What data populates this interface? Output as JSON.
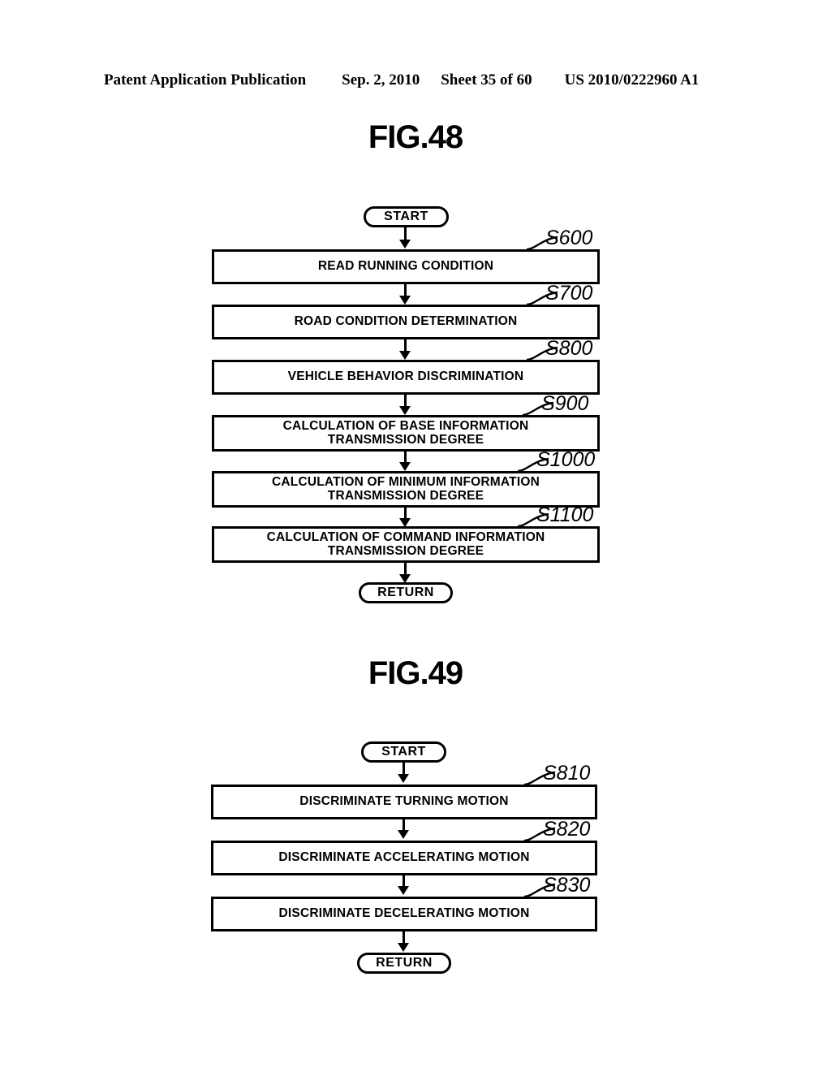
{
  "header": {
    "publication": "Patent Application Publication",
    "date": "Sep. 2, 2010",
    "sheet": "Sheet 35 of 60",
    "patent_number": "US 2010/0222960 A1"
  },
  "figures": [
    {
      "title": "FIG.48",
      "start_label": "START",
      "return_label": "RETURN",
      "steps": [
        {
          "ref": "S600",
          "line1": "READ RUNNING CONDITION",
          "line2": ""
        },
        {
          "ref": "S700",
          "line1": "ROAD CONDITION DETERMINATION",
          "line2": ""
        },
        {
          "ref": "S800",
          "line1": "VEHICLE BEHAVIOR DISCRIMINATION",
          "line2": ""
        },
        {
          "ref": "S900",
          "line1": "CALCULATION OF BASE INFORMATION",
          "line2": "TRANSMISSION DEGREE"
        },
        {
          "ref": "S1000",
          "line1": "CALCULATION OF MINIMUM INFORMATION",
          "line2": "TRANSMISSION DEGREE"
        },
        {
          "ref": "S1100",
          "line1": "CALCULATION OF COMMAND INFORMATION",
          "line2": "TRANSMISSION DEGREE"
        }
      ]
    },
    {
      "title": "FIG.49",
      "start_label": "START",
      "return_label": "RETURN",
      "steps": [
        {
          "ref": "S810",
          "line1": "DISCRIMINATE TURNING MOTION",
          "line2": ""
        },
        {
          "ref": "S820",
          "line1": "DISCRIMINATE ACCELERATING MOTION",
          "line2": ""
        },
        {
          "ref": "S830",
          "line1": "DISCRIMINATE DECELERATING MOTION",
          "line2": ""
        }
      ]
    }
  ],
  "colors": {
    "ink": "#000000",
    "paper": "#ffffff"
  }
}
